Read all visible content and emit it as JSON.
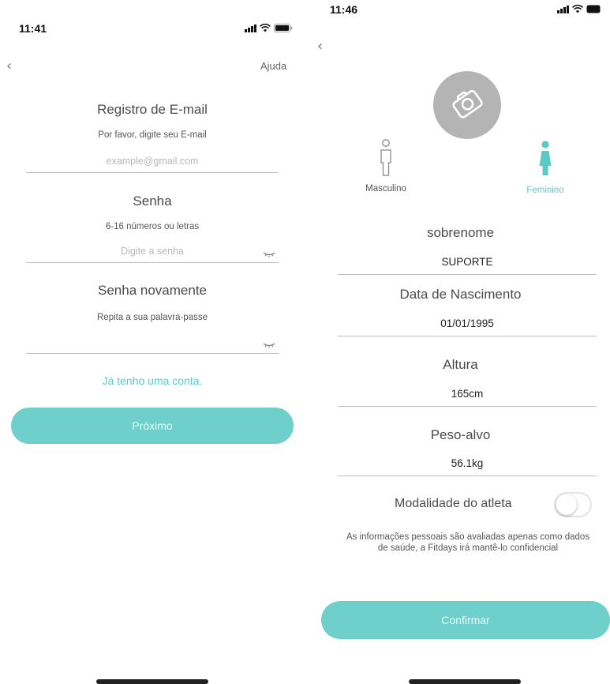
{
  "colors": {
    "accent": "#6ecfcb",
    "accent_text": "#5ccac4",
    "avatar_bg": "#b4b4b4"
  },
  "left": {
    "status_time": "11:41",
    "help_label": "Ajuda",
    "email": {
      "title": "Registro de E-mail",
      "hint": "Por favor, digite seu E-mail",
      "placeholder": "example@gmail.com"
    },
    "password": {
      "title": "Senha",
      "hint": "6-16 números ou letras",
      "placeholder": "Digite a senha"
    },
    "password_repeat": {
      "title": "Senha novamente",
      "hint": "Repita a sua palavra-passe",
      "placeholder": ""
    },
    "have_account_label": "Já tenho uma conta.",
    "next_label": "Próximo"
  },
  "right": {
    "status_time": "11:46",
    "avatar_icon": "camera-icon",
    "gender": {
      "male_label": "Masculino",
      "female_label": "Feminino",
      "selected": "Feminino"
    },
    "surname": {
      "title": "sobrenome",
      "value": "SUPORTE"
    },
    "birth_date": {
      "title": "Data de Nascimento",
      "value": "01/01/1995"
    },
    "height": {
      "title": "Altura",
      "value": "165cm"
    },
    "target_weight": {
      "title": "Peso-alvo",
      "value": "56.1kg"
    },
    "athlete_mode": {
      "label": "Modalidade do atleta",
      "enabled": false
    },
    "privacy_note": "As informações pessoais são avaliadas apenas como dados de saúde, a Fitdays irá mantê-lo confidencial",
    "confirm_label": "Confirmar"
  }
}
